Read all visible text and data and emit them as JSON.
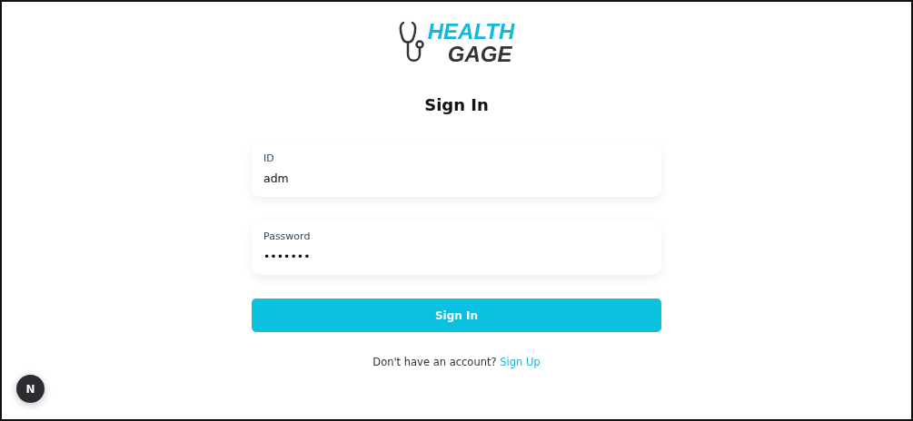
{
  "logo": {
    "line_1": "HEALTH",
    "line_2": "GAGE"
  },
  "title": "Sign In",
  "fields": [
    {
      "label": "ID",
      "value": "adm"
    },
    {
      "label": "Password",
      "value": "•••••••"
    }
  ],
  "submit_button": "Sign In",
  "footer": {
    "text": "Don't have an account?",
    "link": "Sign Up"
  },
  "dev_badge": "N"
}
